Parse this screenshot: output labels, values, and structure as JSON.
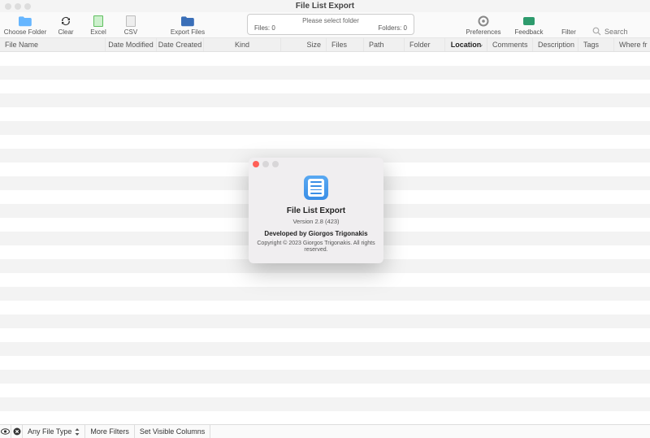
{
  "window": {
    "title": "File List Export"
  },
  "toolbar": {
    "choose_folder": "Choose Folder",
    "clear": "Clear",
    "excel": "Excel",
    "csv": "CSV",
    "export_files": "Export Files",
    "preferences": "Preferences",
    "feedback": "Feedback",
    "filter": "Filter"
  },
  "info": {
    "prompt": "Please select folder",
    "files_label": "Files: 0",
    "folders_label": "Folders: 0"
  },
  "search": {
    "placeholder": "Search"
  },
  "columns": {
    "file_name": "File Name",
    "date_modified": "Date Modified",
    "date_created": "Date Created",
    "kind": "Kind",
    "size": "Size",
    "files": "Files",
    "path": "Path",
    "folder": "Folder",
    "location": "Location",
    "comments": "Comments",
    "description": "Description",
    "tags": "Tags",
    "where_from": "Where fr"
  },
  "bottom": {
    "any_file_type": "Any File Type",
    "more_filters": "More Filters",
    "set_visible_columns": "Set Visible Columns"
  },
  "about": {
    "app_name": "File List Export",
    "version": "Version 2.8 (423)",
    "developer": "Developed by Giorgos Trigonakis",
    "copyright": "Copyright © 2023 Giorgos Trigonakis. All rights reserved."
  }
}
